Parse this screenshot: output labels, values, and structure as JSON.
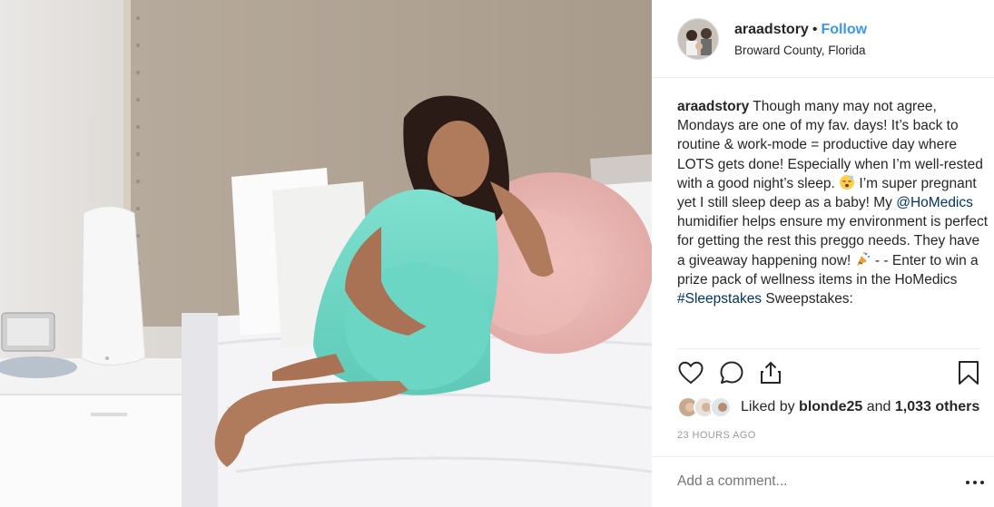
{
  "post": {
    "author": "araadstory",
    "dot": "•",
    "follow_label": "Follow",
    "location": "Broward County, Florida",
    "photo_description_icon": "photo",
    "caption": {
      "username": "araadstory",
      "text_1": " Though many may not agree, Mondays are one of my fav. days! It’s back to routine & work-mode = productive day where LOTS gets done! Especially when I’m well-rested with a good night’s sleep. ",
      "text_2": " I’m super pregnant yet I still sleep deep as a baby! My ",
      "mention": "@HoMedics",
      "text_3": " humidifier helps ensure my environment is perfect for getting the rest this preggo needs. They have a giveaway happening now! ",
      "text_4": " - - Enter to win a prize pack of wellness items in the HoMedics ",
      "hashtag": "#Sleepstakes",
      "text_5": " Sweepstakes:"
    },
    "likes": {
      "prefix": "Liked by ",
      "first_user": "blonde25",
      "conj": " and ",
      "others": "1,033 others"
    },
    "time": "23 HOURS AGO",
    "comment_placeholder": "Add a comment...",
    "icons": {
      "like": "heart-icon",
      "comment": "comment-icon",
      "share": "share-icon",
      "save": "bookmark-icon",
      "more": "more-options-icon",
      "emoji_sleep": "sleeping-face-emoji",
      "emoji_party": "party-popper-emoji"
    },
    "colors": {
      "follow": "#3897f0",
      "link": "#003569",
      "muted": "#999999",
      "text": "#262626"
    }
  }
}
